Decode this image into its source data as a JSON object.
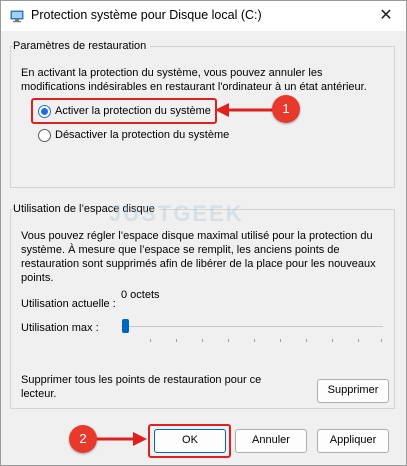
{
  "window": {
    "title": "Protection système pour Disque local (C:)",
    "close_glyph": "✕"
  },
  "restore": {
    "group_title": "Paramètres de restauration",
    "description": "En activant la protection du système, vous pouvez annuler les modifications indésirables en restaurant l'ordinateur à un état antérieur.",
    "options": [
      {
        "label": "Activer la protection du système",
        "selected": true
      },
      {
        "label": "Désactiver la protection du système",
        "selected": false
      }
    ]
  },
  "disk": {
    "group_title": "Utilisation de l’espace disque",
    "description": "Vous pouvez régler l’espace disque maximal utilisé pour la protection du système. À mesure que l’espace se remplit, les anciens points de restauration sont supprimés afin de libérer de la place pour les nouveaux points.",
    "current_label": "Utilisation actuelle :",
    "current_value": "0 octets",
    "max_label": "Utilisation max :",
    "max_value_fraction": 0,
    "delete_text": "Supprimer tous les points de restauration pour ce lecteur.",
    "delete_button": "Supprimer"
  },
  "annotations": {
    "badge1": "1",
    "badge2": "2",
    "accent": "#e0201f"
  },
  "watermark": "JUSTGEEK",
  "footer": {
    "ok": "OK",
    "cancel": "Annuler",
    "apply": "Appliquer"
  }
}
